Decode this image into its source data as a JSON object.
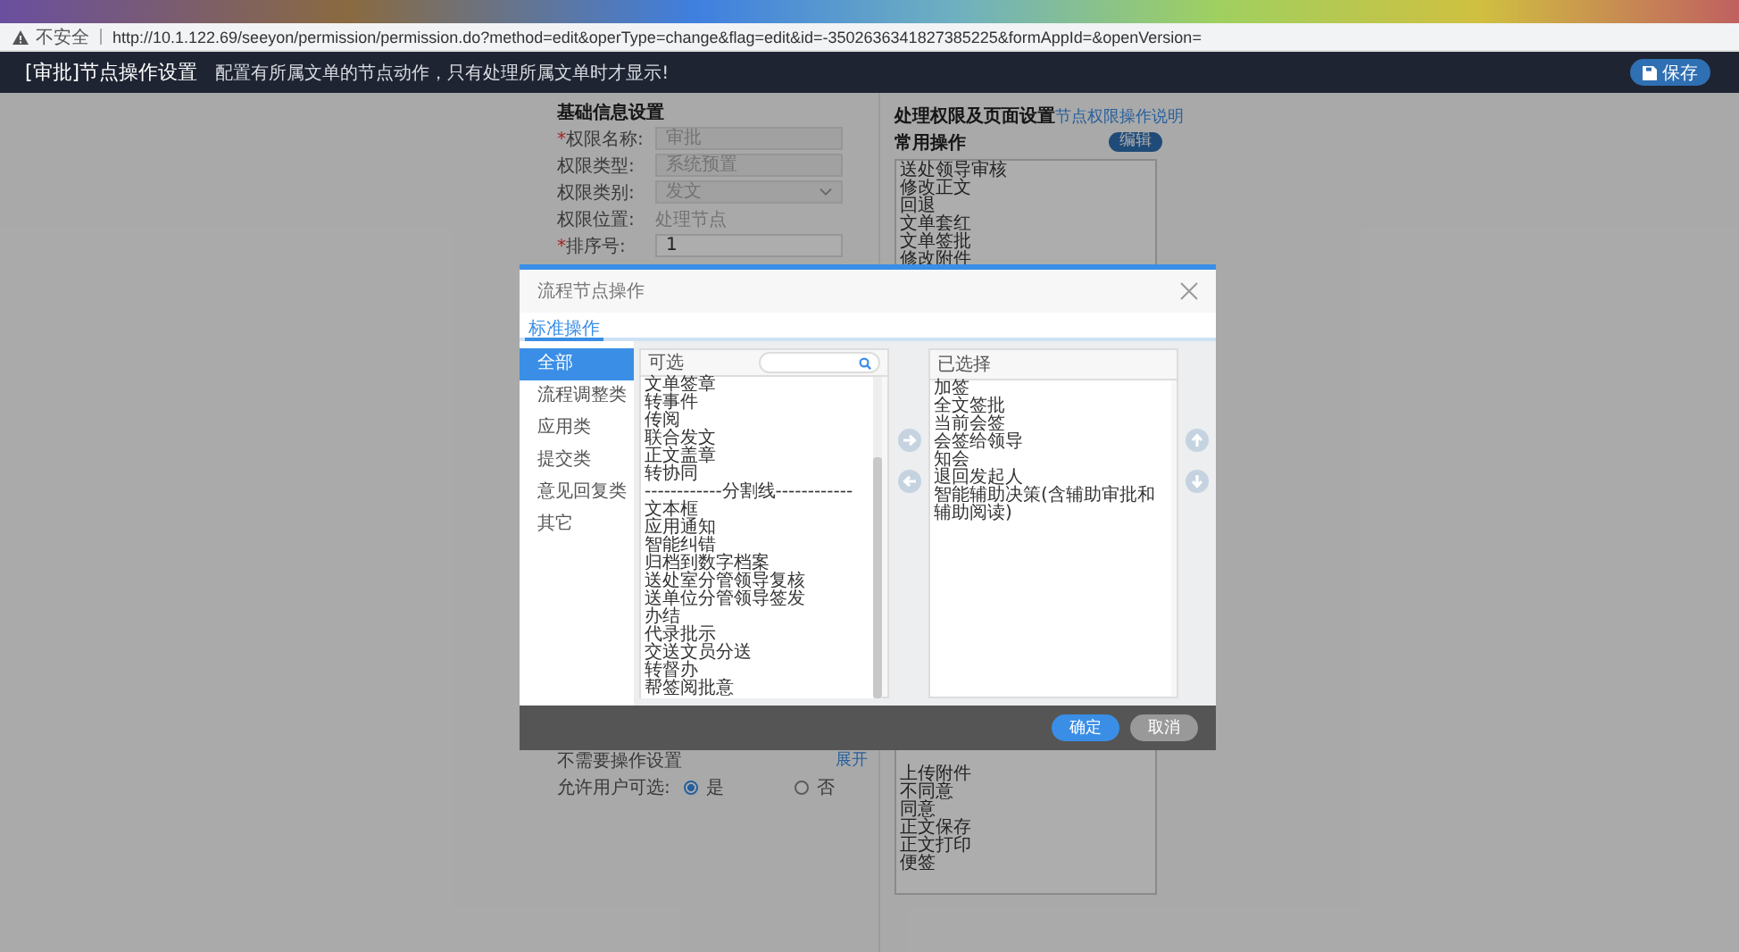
{
  "browser": {
    "security_label": "不安全",
    "url": "http://10.1.122.69/seeyon/permission/permission.do?method=edit&operType=change&flag=edit&id=-3502636341827385225&formAppId=&openVersion="
  },
  "header": {
    "title": "[审批]节点操作设置",
    "subtitle": "配置有所属文单的节点动作，只有处理所属文单时才显示!",
    "save_button": "保存"
  },
  "basic_info": {
    "title": "基础信息设置",
    "fields": [
      {
        "required_mark": "*",
        "label": "权限名称:",
        "kind": "readonly",
        "value": "审批"
      },
      {
        "label": "权限类型:",
        "kind": "readonly",
        "value": "系统预置"
      },
      {
        "label": "权限类别:",
        "kind": "select",
        "value": "发文"
      },
      {
        "label": "权限位置:",
        "kind": "plain",
        "value": "处理节点"
      },
      {
        "required_mark": "*",
        "label": "排序号:",
        "kind": "input",
        "value": "1"
      }
    ]
  },
  "permissions": {
    "title": "处理权限及页面设置",
    "help_link": "节点权限操作说明",
    "common_ops_label": "常用操作",
    "edit_button": "编辑",
    "common_ops_top": [
      "送处领导审核",
      "修改正文",
      "回退",
      "文单套红",
      "文单签批",
      "修改附件"
    ],
    "common_ops_bottom": [
      "上传附件",
      "不同意",
      "同意",
      "正文保存",
      "正文打印",
      "便签"
    ]
  },
  "other_settings": {
    "label": "不需要操作设置",
    "toggle_link": "展开",
    "allow_label": "允许用户可选:",
    "options": [
      {
        "label": "是",
        "selected": true
      },
      {
        "label": "否",
        "selected": false
      }
    ]
  },
  "dialog": {
    "title": "流程节点操作",
    "tabs": [
      {
        "label": "标准操作",
        "selected": true
      }
    ],
    "categories": [
      {
        "label": "全部",
        "selected": true
      },
      {
        "label": "流程调整类",
        "selected": false
      },
      {
        "label": "应用类",
        "selected": false
      },
      {
        "label": "提交类",
        "selected": false
      },
      {
        "label": "意见回复类",
        "selected": false
      },
      {
        "label": "其它",
        "selected": false
      }
    ],
    "available": {
      "title": "可选",
      "items": [
        "文单签章",
        "转事件",
        "传阅",
        "联合发文",
        "正文盖章",
        "转协同",
        "------------分割线------------",
        "文本框",
        "应用通知",
        "智能纠错",
        "归档到数字档案",
        "送处室分管领导复核",
        "送单位分管领导签发",
        "办结",
        "代录批示",
        "交送文员分送",
        "转督办",
        "帮签阅批意"
      ]
    },
    "chosen": {
      "title": "已选择",
      "items": [
        "加签",
        "全文签批",
        "当前会签",
        "会签给领导",
        "知会",
        "退回发起人",
        "智能辅助决策(含辅助审批和辅助阅读)"
      ]
    },
    "confirm_button": "确定",
    "cancel_button": "取消"
  }
}
